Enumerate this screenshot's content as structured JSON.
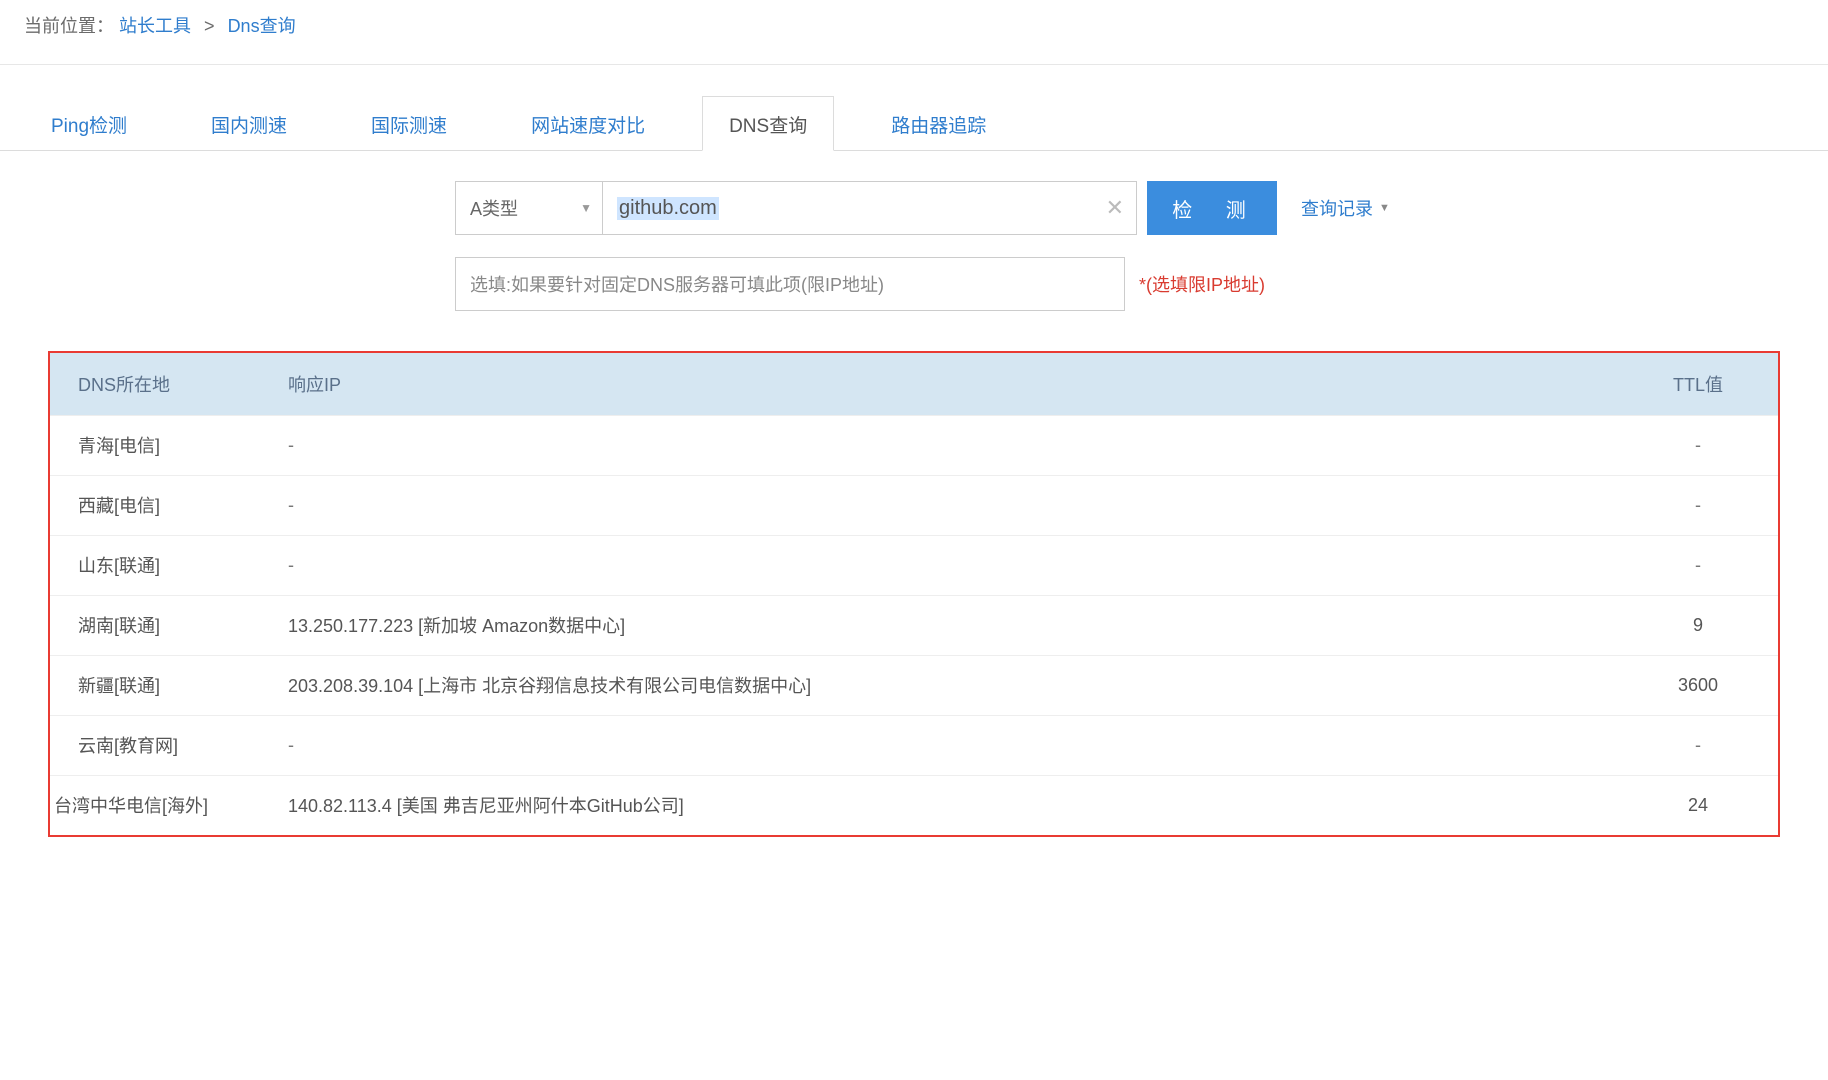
{
  "breadcrumb": {
    "label": "当前位置：",
    "link1": "站长工具",
    "sep": ">",
    "link2": "Dns查询"
  },
  "tabs": [
    {
      "id": "ping",
      "label": "Ping检测",
      "active": false
    },
    {
      "id": "domestic",
      "label": "国内测速",
      "active": false
    },
    {
      "id": "intl",
      "label": "国际测速",
      "active": false
    },
    {
      "id": "compare",
      "label": "网站速度对比",
      "active": false
    },
    {
      "id": "dns",
      "label": "DNS查询",
      "active": true
    },
    {
      "id": "trace",
      "label": "路由器追踪",
      "active": false
    }
  ],
  "query": {
    "record_type": "A类型",
    "domain": "github.com",
    "submit_label": "检 测",
    "history_label": "查询记录",
    "server_placeholder": "选填:如果要针对固定DNS服务器可填此项(限IP地址)",
    "note": "*(选填限IP地址)"
  },
  "columns": {
    "loc": "DNS所在地",
    "ip": "响应IP",
    "ttl": "TTL值"
  },
  "rows": [
    {
      "loc": "青海[电信]",
      "ip": "-",
      "ttl": "-"
    },
    {
      "loc": "西藏[电信]",
      "ip": "-",
      "ttl": "-"
    },
    {
      "loc": "山东[联通]",
      "ip": "-",
      "ttl": "-"
    },
    {
      "loc": "湖南[联通]",
      "ip": "13.250.177.223 [新加坡 Amazon数据中心]",
      "ttl": "9"
    },
    {
      "loc": "新疆[联通]",
      "ip": "203.208.39.104 [上海市 北京谷翔信息技术有限公司电信数据中心]",
      "ttl": "3600"
    },
    {
      "loc": "云南[教育网]",
      "ip": "-",
      "ttl": "-"
    },
    {
      "loc": "台湾中华电信[海外]",
      "ip": "140.82.113.4 [美国 弗吉尼亚州阿什本GitHub公司]",
      "ttl": "24",
      "wide": true
    }
  ]
}
